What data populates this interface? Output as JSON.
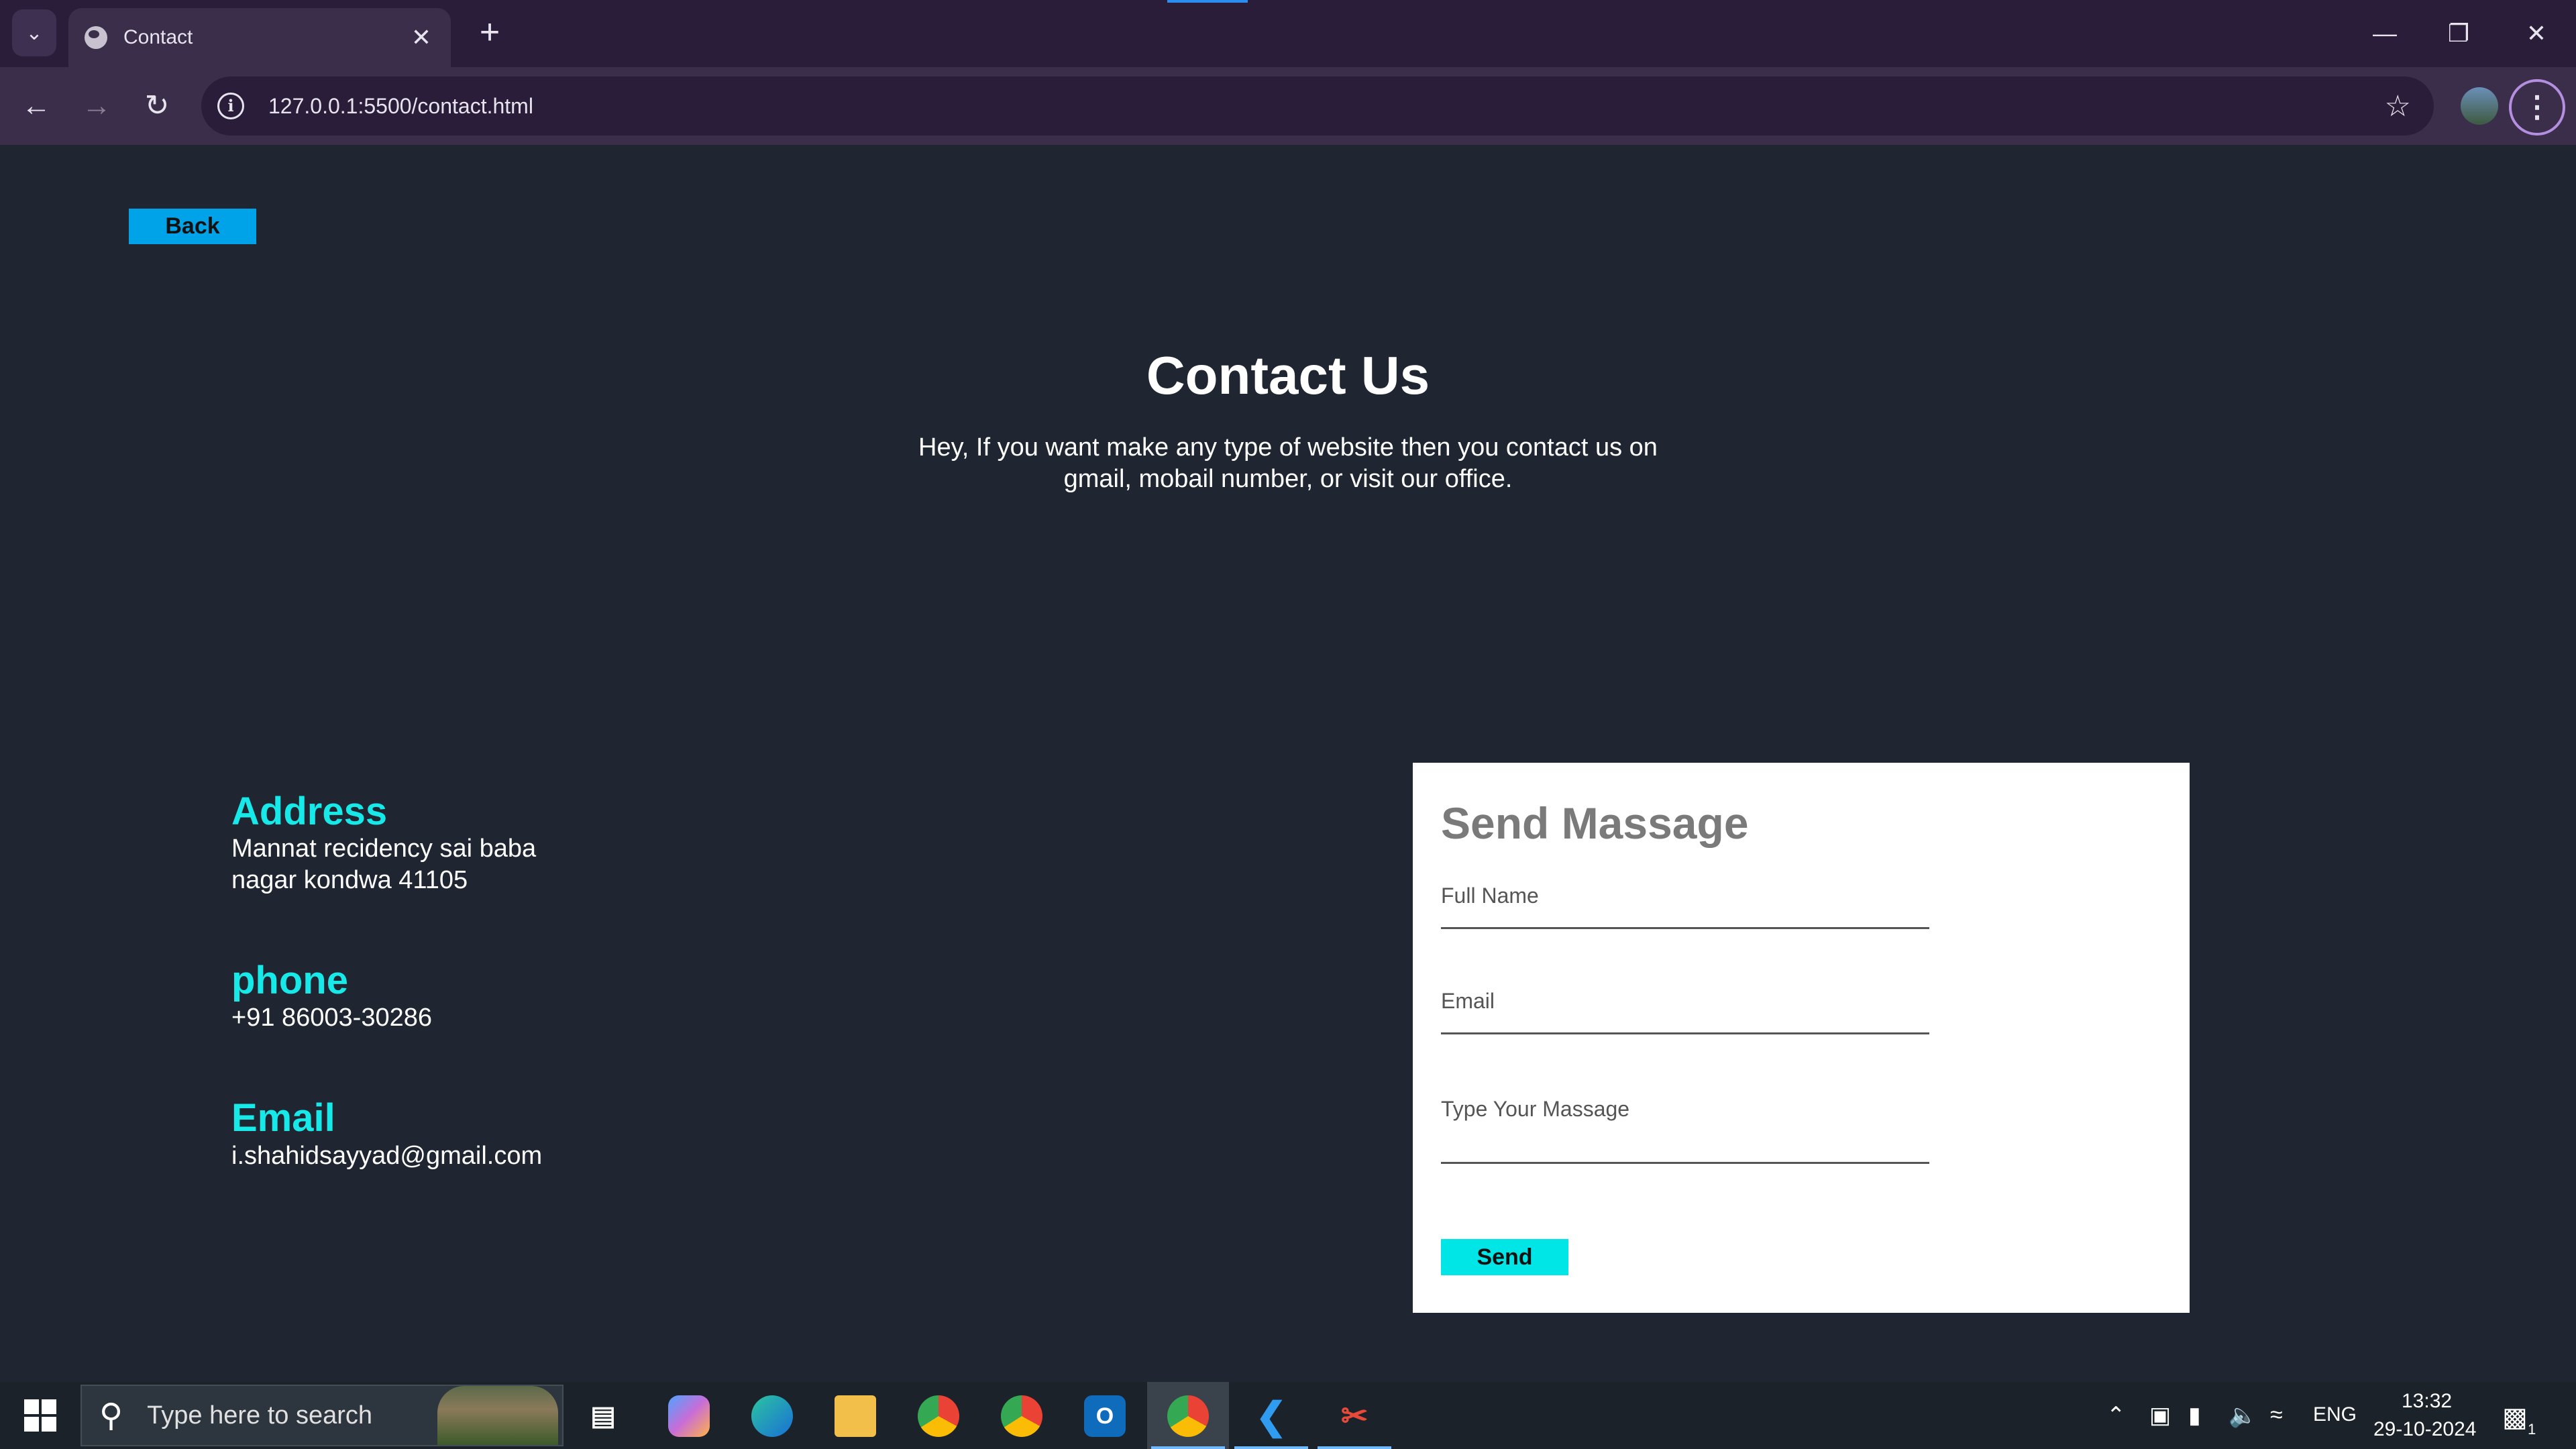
{
  "browser": {
    "tab_title": "Contact",
    "url": "127.0.0.1:5500/contact.html"
  },
  "page": {
    "back_label": "Back",
    "title": "Contact Us",
    "intro": "Hey, If you want make any type of website then you contact us on gmail, mobail number, or visit our office.",
    "address_heading": "Address",
    "address_line1": "Mannat recidency sai baba",
    "address_line2": "nagar kondwa 41105",
    "phone_heading": "phone",
    "phone_value": "+91 86003-30286",
    "email_heading": "Email",
    "email_value": "i.shahidsayyad@gmail.com",
    "accent_color": "#17e8e8",
    "button_color": "#00a2e8"
  },
  "form": {
    "title": "Send Massage",
    "full_name_label": "Full Name",
    "email_label": "Email",
    "message_label": "Type Your Massage",
    "send_label": "Send"
  },
  "taskbar": {
    "search_placeholder": "Type here to search",
    "language": "ENG",
    "time": "13:32",
    "date": "29-10-2024",
    "notification_count": "1"
  }
}
